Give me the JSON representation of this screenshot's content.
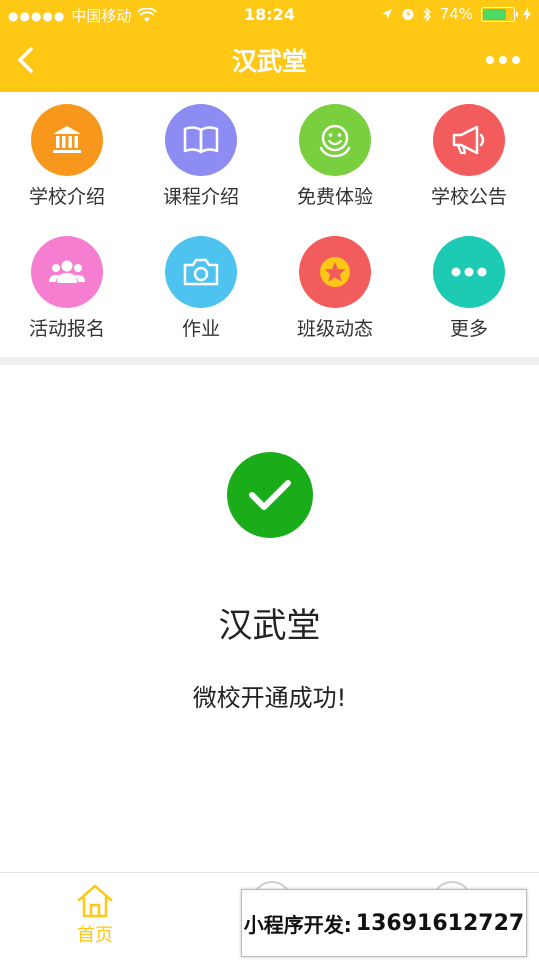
{
  "status_bar": {
    "carrier": "中国移动",
    "time": "18:24",
    "battery": "74%"
  },
  "nav": {
    "title": "汉武堂"
  },
  "grid": {
    "items": [
      {
        "label": "学校介绍",
        "icon": "bank-icon",
        "color": "#F7981C"
      },
      {
        "label": "课程介绍",
        "icon": "book-icon",
        "color": "#8C8CF2"
      },
      {
        "label": "免费体验",
        "icon": "smile-icon",
        "color": "#7ACF3E"
      },
      {
        "label": "学校公告",
        "icon": "megaphone-icon",
        "color": "#F25C5C"
      },
      {
        "label": "活动报名",
        "icon": "group-icon",
        "color": "#F57ED0"
      },
      {
        "label": "作业",
        "icon": "camera-icon",
        "color": "#4FC3F0"
      },
      {
        "label": "班级动态",
        "icon": "star-icon",
        "color": "#F25C5C"
      },
      {
        "label": "更多",
        "icon": "more-dots-icon",
        "color": "#1DCBB4"
      }
    ]
  },
  "main": {
    "school_name": "汉武堂",
    "success_message": "微校开通成功!"
  },
  "tabbar": {
    "home_label": "首页"
  },
  "promo": {
    "label": "小程序开发:",
    "phone": "13691612727"
  },
  "colors": {
    "brand": "#FFC814",
    "success": "#1AAD19"
  }
}
